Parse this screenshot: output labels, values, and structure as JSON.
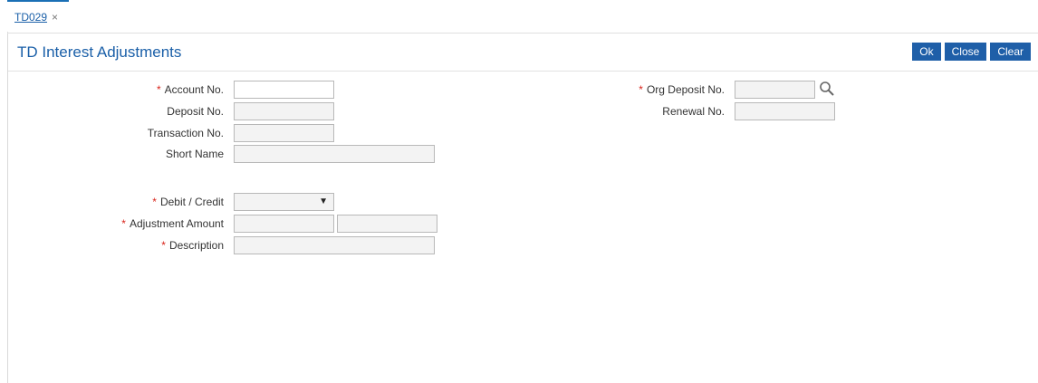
{
  "tab": {
    "label": "TD029",
    "close": "×"
  },
  "page": {
    "title": "TD Interest Adjustments"
  },
  "buttons": {
    "ok": "Ok",
    "close": "Close",
    "clear": "Clear"
  },
  "form": {
    "account_no": {
      "label": "Account No.",
      "value": "",
      "required": true
    },
    "org_deposit_no": {
      "label": "Org Deposit No.",
      "value": "",
      "required": true
    },
    "deposit_no": {
      "label": "Deposit No.",
      "value": ""
    },
    "renewal_no": {
      "label": "Renewal No.",
      "value": ""
    },
    "transaction_no": {
      "label": "Transaction No.",
      "value": ""
    },
    "short_name": {
      "label": "Short Name",
      "value": ""
    },
    "debit_credit": {
      "label": "Debit / Credit",
      "value": "",
      "required": true
    },
    "adjustment_amount": {
      "label": "Adjustment Amount",
      "currency": "",
      "value": "",
      "required": true
    },
    "description": {
      "label": "Description",
      "value": "",
      "required": true
    }
  },
  "required_marker": "*",
  "icons": {
    "search": "search-icon",
    "dropdown": "caret-down-icon"
  },
  "colors": {
    "accent": "#1f5fa8",
    "required": "#d9251c"
  }
}
